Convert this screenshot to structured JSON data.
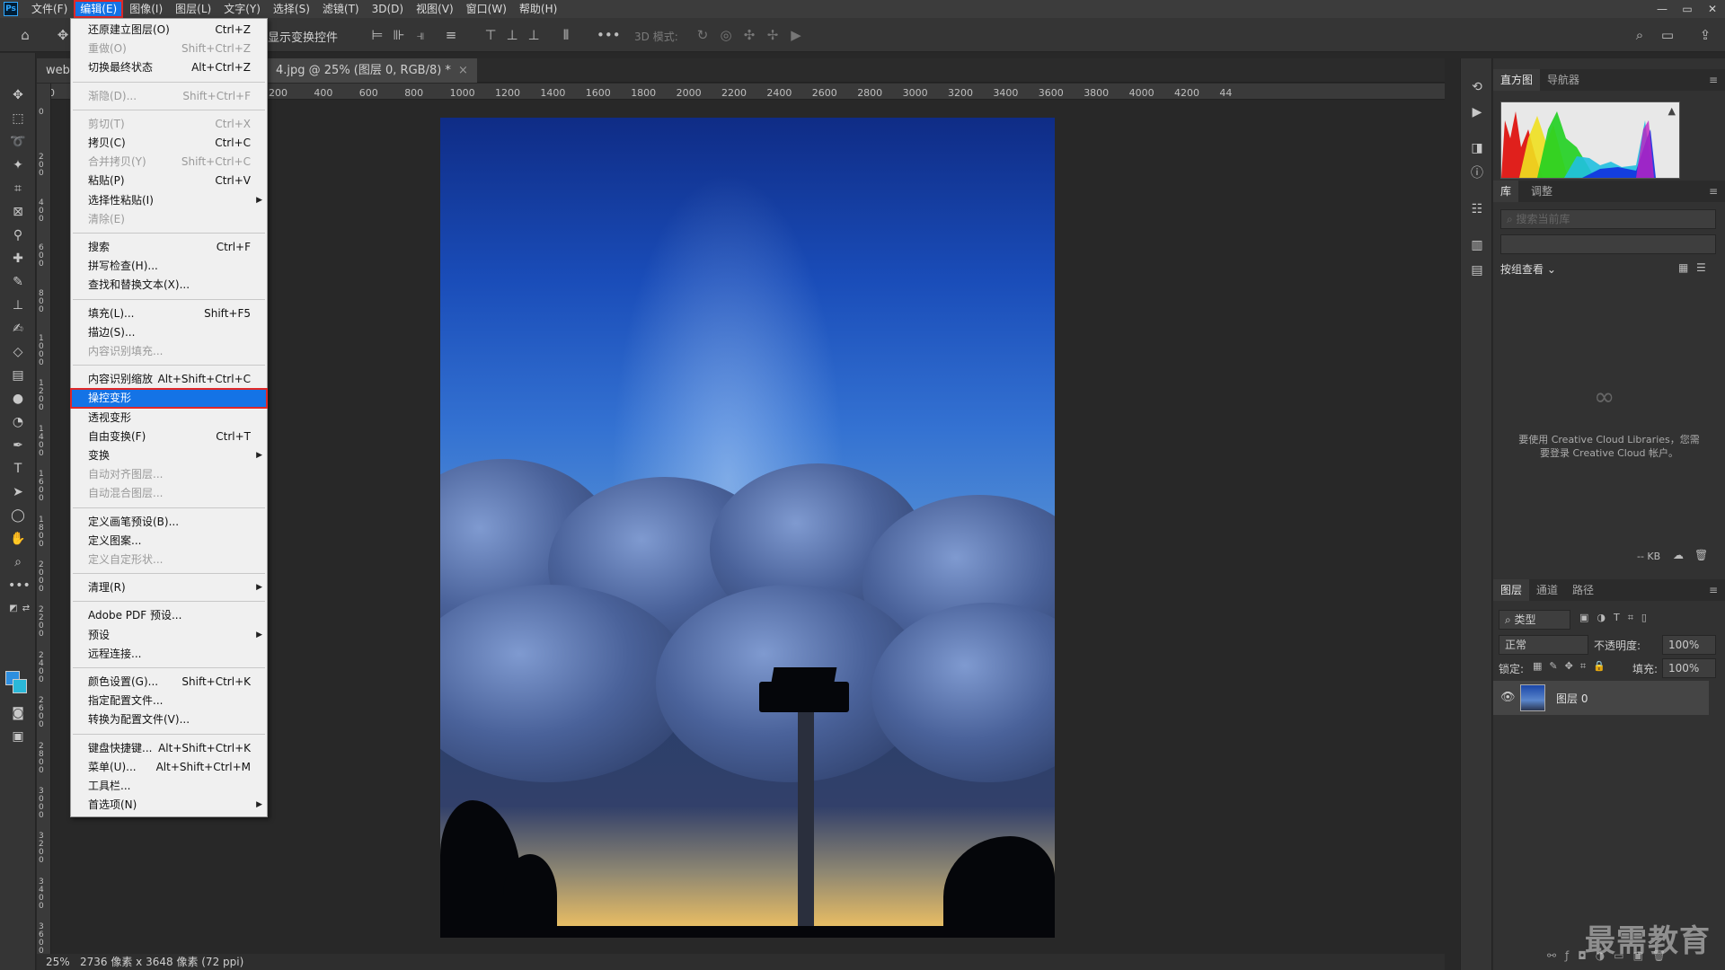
{
  "menubar": {
    "logo": "Ps",
    "items": [
      "文件(F)",
      "编辑(E)",
      "图像(I)",
      "图层(L)",
      "文字(Y)",
      "选择(S)",
      "滤镜(T)",
      "3D(D)",
      "视图(V)",
      "窗口(W)",
      "帮助(H)"
    ],
    "active_index": 1,
    "win_controls": [
      "—",
      "▭",
      "✕"
    ]
  },
  "optionsbar": {
    "transform_label": "显示变换控件",
    "mode_3d": "3D 模式:",
    "more": "•••"
  },
  "doc_tabs": {
    "tab1": "webu",
    "tab2": "4.jpg @ 25% (图层 0, RGB/8) *",
    "close": "×"
  },
  "ruler_h": [
    "00",
    "600",
    "400",
    "200",
    "0",
    "200",
    "400",
    "600",
    "800",
    "1000",
    "1200",
    "1400",
    "1600",
    "1800",
    "2000",
    "2200",
    "2400",
    "2600",
    "2800",
    "3000",
    "3200",
    "3400",
    "3600",
    "3800",
    "4000",
    "4200",
    "44"
  ],
  "ruler_v": [
    "0",
    "2 0 0",
    "4 0 0",
    "6 0 0",
    "8 0 0",
    "1 0 0 0",
    "1 2 0 0",
    "1 4 0 0",
    "1 6 0 0",
    "1 8 0 0",
    "2 0 0 0",
    "2 2 0 0",
    "2 4 0 0",
    "2 6 0 0",
    "2 8 0 0",
    "3 0 0 0",
    "3 2 0 0",
    "3 4 0 0",
    "3 6 0 0"
  ],
  "ruler_corner": "30",
  "status": {
    "zoom": "25%",
    "info": "2736 像素 x 3648 像素 (72 ppi)"
  },
  "edit_menu": {
    "groups": [
      [
        {
          "label": "还原建立图层(O)",
          "shortcut": "Ctrl+Z",
          "disabled": false
        },
        {
          "label": "重做(O)",
          "shortcut": "Shift+Ctrl+Z",
          "disabled": true
        },
        {
          "label": "切换最终状态",
          "shortcut": "Alt+Ctrl+Z",
          "disabled": false
        }
      ],
      [
        {
          "label": "渐隐(D)...",
          "shortcut": "Shift+Ctrl+F",
          "disabled": true
        }
      ],
      [
        {
          "label": "剪切(T)",
          "shortcut": "Ctrl+X",
          "disabled": true
        },
        {
          "label": "拷贝(C)",
          "shortcut": "Ctrl+C",
          "disabled": false
        },
        {
          "label": "合并拷贝(Y)",
          "shortcut": "Shift+Ctrl+C",
          "disabled": true
        },
        {
          "label": "粘贴(P)",
          "shortcut": "Ctrl+V",
          "disabled": false
        },
        {
          "label": "选择性粘贴(I)",
          "shortcut": "",
          "disabled": false,
          "submenu": true
        },
        {
          "label": "清除(E)",
          "shortcut": "",
          "disabled": true
        }
      ],
      [
        {
          "label": "搜索",
          "shortcut": "Ctrl+F",
          "disabled": false
        },
        {
          "label": "拼写检查(H)...",
          "shortcut": "",
          "disabled": false
        },
        {
          "label": "查找和替换文本(X)...",
          "shortcut": "",
          "disabled": false
        }
      ],
      [
        {
          "label": "填充(L)...",
          "shortcut": "Shift+F5",
          "disabled": false
        },
        {
          "label": "描边(S)...",
          "shortcut": "",
          "disabled": false
        },
        {
          "label": "内容识别填充...",
          "shortcut": "",
          "disabled": true
        }
      ],
      [
        {
          "label": "内容识别缩放",
          "shortcut": "Alt+Shift+Ctrl+C",
          "disabled": false
        },
        {
          "label": "操控变形",
          "shortcut": "",
          "disabled": false,
          "selected": true
        },
        {
          "label": "透视变形",
          "shortcut": "",
          "disabled": false
        },
        {
          "label": "自由变换(F)",
          "shortcut": "Ctrl+T",
          "disabled": false
        },
        {
          "label": "变换",
          "shortcut": "",
          "disabled": false,
          "submenu": true
        },
        {
          "label": "自动对齐图层...",
          "shortcut": "",
          "disabled": true
        },
        {
          "label": "自动混合图层...",
          "shortcut": "",
          "disabled": true
        }
      ],
      [
        {
          "label": "定义画笔预设(B)...",
          "shortcut": "",
          "disabled": false
        },
        {
          "label": "定义图案...",
          "shortcut": "",
          "disabled": false
        },
        {
          "label": "定义自定形状...",
          "shortcut": "",
          "disabled": true
        }
      ],
      [
        {
          "label": "清理(R)",
          "shortcut": "",
          "disabled": false,
          "submenu": true
        }
      ],
      [
        {
          "label": "Adobe PDF 预设...",
          "shortcut": "",
          "disabled": false
        },
        {
          "label": "预设",
          "shortcut": "",
          "disabled": false,
          "submenu": true
        },
        {
          "label": "远程连接...",
          "shortcut": "",
          "disabled": false
        }
      ],
      [
        {
          "label": "颜色设置(G)...",
          "shortcut": "Shift+Ctrl+K",
          "disabled": false
        },
        {
          "label": "指定配置文件...",
          "shortcut": "",
          "disabled": false
        },
        {
          "label": "转换为配置文件(V)...",
          "shortcut": "",
          "disabled": false
        }
      ],
      [
        {
          "label": "键盘快捷键...",
          "shortcut": "Alt+Shift+Ctrl+K",
          "disabled": false
        },
        {
          "label": "菜单(U)...",
          "shortcut": "Alt+Shift+Ctrl+M",
          "disabled": false
        },
        {
          "label": "工具栏...",
          "shortcut": "",
          "disabled": false
        },
        {
          "label": "首选项(N)",
          "shortcut": "",
          "disabled": false,
          "submenu": true
        }
      ]
    ]
  },
  "panels": {
    "histogram_tabs": [
      "直方图",
      "导航器"
    ],
    "hist_warning": "▲",
    "library_tabs": [
      "库",
      "调整"
    ],
    "library_search_placeholder": "搜索当前库",
    "library_view": "按组查看",
    "library_message": "要使用 Creative Cloud Libraries，您需要登录 Creative Cloud 帐户。",
    "library_size": "-- KB",
    "layers_tabs": [
      "图层",
      "通道",
      "路径"
    ],
    "filter_kind": "类型",
    "blend_mode": "正常",
    "opacity_label": "不透明度:",
    "opacity_value": "100%",
    "lock_label": "锁定:",
    "fill_label": "填充:",
    "fill_value": "100%",
    "layer_name": "图层 0"
  },
  "watermark": "最需教育",
  "colors": {
    "foreground": "#2e8fe0",
    "background": "#2ab8d8",
    "accent": "#1473e6",
    "highlight": "#e02828"
  }
}
